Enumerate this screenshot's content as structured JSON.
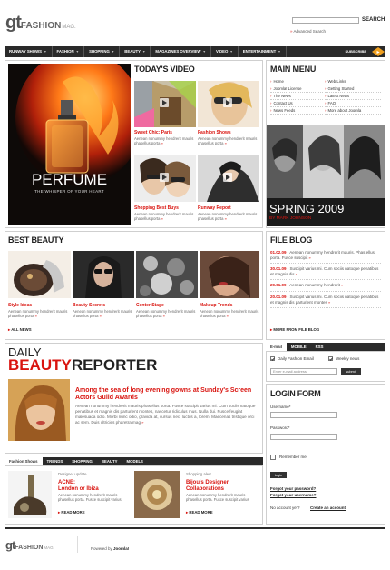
{
  "header": {
    "logo_gt": "gt",
    "logo_fashion": "FASHION",
    "logo_mag": "MAG.",
    "search_label": "SEARCH",
    "advanced_search": "Advanced Search"
  },
  "nav": {
    "items": [
      "RUNWAY SHOWS",
      "FASHION",
      "SHOPPING",
      "BEAUTY",
      "MAGAZINES OVERVIEW",
      "VIDEO",
      "ENTERTAINMENT"
    ],
    "subscribe": "SUBSCRIBE"
  },
  "feature": {
    "title": "PERFUME",
    "subtitle": "THE WHISPER OF YOUR HEART"
  },
  "video": {
    "heading": "TODAY'S VIDEO",
    "items": [
      {
        "title": "Sweet Chic: Paris",
        "text": "Aenean nonummy hendrerit mauris phasellus porta"
      },
      {
        "title": "Fashion Shows",
        "text": "Aenean nonummy hendrerit mauris phasellus porta"
      },
      {
        "title": "Shopping Best Buys",
        "text": "Aenean nonummy hendrerit mauris phasellus porta"
      },
      {
        "title": "Runway Report",
        "text": "Aenean nonummy hendrerit mauris phasellus porta"
      }
    ]
  },
  "main_menu": {
    "heading": "MAIN MENU",
    "left": [
      "Home",
      "Joomla! License",
      "The News",
      "Contact Us",
      "News Feeds"
    ],
    "right": [
      "Web Links",
      "Getting Started",
      "Latest News",
      "FAQ",
      "More about Joomla"
    ]
  },
  "spring": {
    "title": "SPRING 2009",
    "by": "BY MARK JOHNSON"
  },
  "beauty": {
    "heading": "BEST BEAUTY",
    "items": [
      {
        "title": "Style Ideas",
        "text": "Aenean nonummy hendrerit mauris phasellus porta"
      },
      {
        "title": "Beauty Secrets",
        "text": "Aenean nonummy hendrerit mauris phasellus porta"
      },
      {
        "title": "Center Stage",
        "text": "Aenean nonummy hendrerit mauris phasellus porta"
      },
      {
        "title": "Makeup Trends",
        "text": "Aenean nonummy hendrerit mauris phasellus porta"
      }
    ],
    "all_news": "ALL NEWS"
  },
  "blog": {
    "heading": "FILE BLOG",
    "items": [
      {
        "date": "01.02.09",
        "text": "- Aenean nonummy hendrerit mauris. Phas ellus porta. Fusce suscipit"
      },
      {
        "date": "30.01.09",
        "text": "- Suscipit varius mi. Cum sociis natoque penatibus et magnis dis"
      },
      {
        "date": "29.01.09",
        "text": "- Aenean nonummy hendrerit"
      },
      {
        "date": "20.01.09",
        "text": "- Suscipit varius mi. Cum sociis natoque penatibus et magnis dis parturient montes"
      }
    ],
    "more": "MORE FROM FILE BLOG"
  },
  "email": {
    "tabs": [
      "E-mail",
      "MOBILE",
      "RSS"
    ],
    "daily": "Daily Fashion Email",
    "weekly": "Weekly news",
    "placeholder": "Enter e-mail address",
    "submit": "submit"
  },
  "reporter": {
    "daily": "DAILY",
    "beauty": "BEAUTY",
    "reporter": "REPORTER",
    "headline": "Among the sea of long evening gowns at Sunday's Screen Actors Guild Awards",
    "body": "Aenean nonummy hendrerit mauris phasellus porta. Fusce suscipit varius mi. Cum sociis natoque penatibus et magnis dis parturient montes, nascetur ridiculus mus. Nulla dui. Fusce feugiat malesuada odio. Morbi nunc odio, gravida at, cursus nec, luctus a, lorem. Maecenas tristique orci ac sem. Duis ultricies pharetra mag"
  },
  "login": {
    "heading": "LOGIN FORM",
    "username": "Username*",
    "password": "Password*",
    "remember": "Remember me",
    "button": "login",
    "forgot_password": "Forgot your password?",
    "forgot_username": "Forgot your username?",
    "no_account": "No account yet?",
    "create": "Create an account"
  },
  "bottom_tabs": {
    "tabs": [
      "Fashion Shows",
      "TRENDS",
      "SHOPPING",
      "BEAUTY",
      "MODELS"
    ],
    "items": [
      {
        "cat": "Designer update",
        "title": "ACNE:",
        "title2": "London or Ibiza",
        "text": "Aenean nonummy hendrerit mauris phasellus porta. Fusce suscipit varius",
        "more": "READ MORE"
      },
      {
        "cat": "Shopping alert",
        "title": "Bijou's Designer",
        "title2": "Collaborations",
        "text": "Aenean nonummy hendrerit mauris phasellus porta. Fusce suscipit varius",
        "more": "READ MORE"
      }
    ]
  },
  "footer": {
    "logo_gt": "gt",
    "logo_fashion": "FASHION",
    "logo_mag": "MAG.",
    "powered": "Powered by",
    "joomla": "Joomla!"
  },
  "colors": {
    "accent": "#d9140f",
    "dark": "#2a2a2a",
    "orange": "#f0a020"
  }
}
